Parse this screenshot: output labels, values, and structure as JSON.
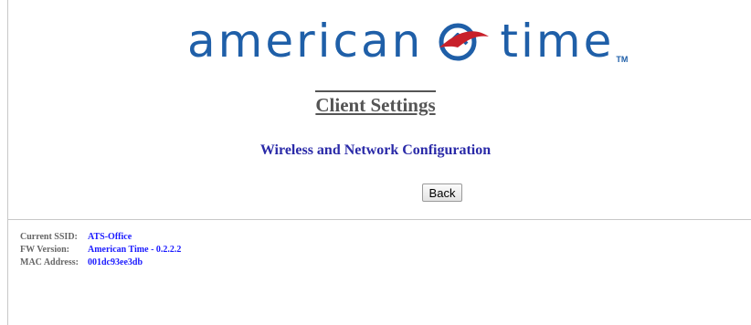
{
  "brand": {
    "word_left": "american",
    "word_right": "time",
    "trademark": "TM",
    "color": "#1f5fa8",
    "accent": "#c8202a"
  },
  "page": {
    "title": "Client Settings",
    "subtitle": "Wireless and Network Configuration",
    "back_label": "Back"
  },
  "info": {
    "rows": [
      {
        "label": "Current SSID:",
        "value": "ATS-Office"
      },
      {
        "label": "FW Version:",
        "value": "American Time - 0.2.2.2"
      },
      {
        "label": "MAC Address:",
        "value": "001dc93ee3db"
      }
    ]
  },
  "colors": {
    "title": "#555555",
    "subtitle": "#2a2aa8",
    "info_label": "#666666",
    "info_value": "#1a1aff"
  }
}
